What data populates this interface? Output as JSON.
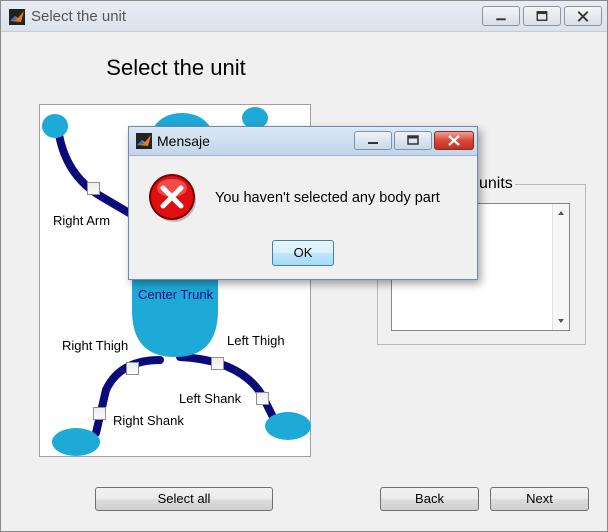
{
  "window": {
    "title": "Select the unit"
  },
  "heading": "Select the unit",
  "body_parts": {
    "right_arm": "Right Arm",
    "center_trunk": "Center Trunk",
    "right_thigh": "Right Thigh",
    "left_thigh": "Left Thigh",
    "left_shank": "Left Shank",
    "right_shank": "Right Shank"
  },
  "units_group": {
    "title": "units"
  },
  "buttons": {
    "select_all": "Select all",
    "back": "Back",
    "next": "Next"
  },
  "dialog": {
    "title": "Mensaje",
    "message": "You haven't selected any body part",
    "ok": "OK"
  },
  "colors": {
    "limb": "#0a0a7a",
    "joint": "#1eaad6",
    "close_button": "#d9473a",
    "error_icon": "#e01010"
  }
}
